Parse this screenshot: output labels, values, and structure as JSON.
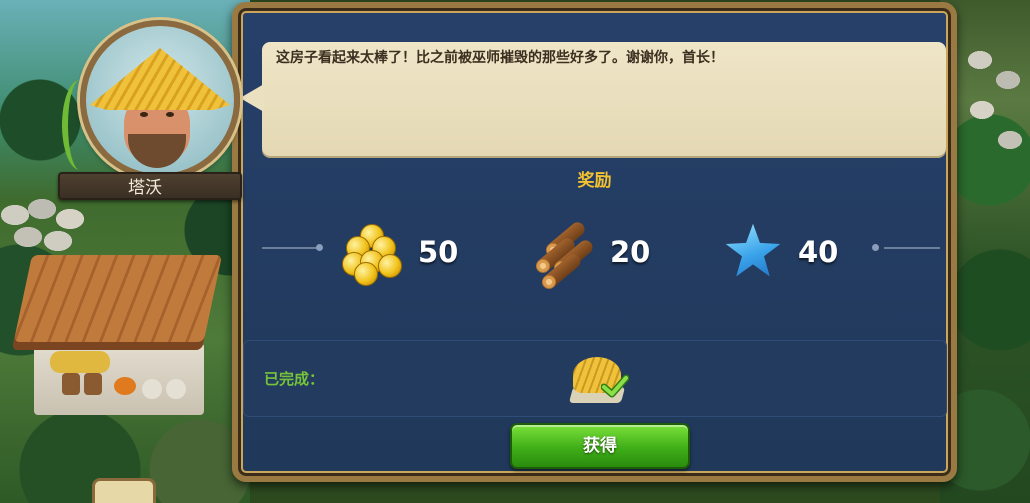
{
  "npc": {
    "name": "塔沃",
    "dialogue": "这房子看起来太棒了！比之前被巫师摧毁的那些好多了。谢谢你，首长！"
  },
  "rewards": {
    "title": "奖励",
    "items": [
      {
        "icon": "gold-coins-icon",
        "amount": "50"
      },
      {
        "icon": "wood-logs-icon",
        "amount": "20"
      },
      {
        "icon": "blue-star-icon",
        "amount": "40"
      }
    ]
  },
  "completed": {
    "label": "已完成：",
    "item_icon": "thatched-hut-icon",
    "status_icon": "checkmark-icon"
  },
  "actions": {
    "claim_label": "获得"
  },
  "colors": {
    "panel_bg": "#27406a",
    "panel_border": "#9a7a42",
    "reward_title": "#f2c230",
    "completed_label": "#76c33b",
    "button_green": "#3fae18"
  }
}
